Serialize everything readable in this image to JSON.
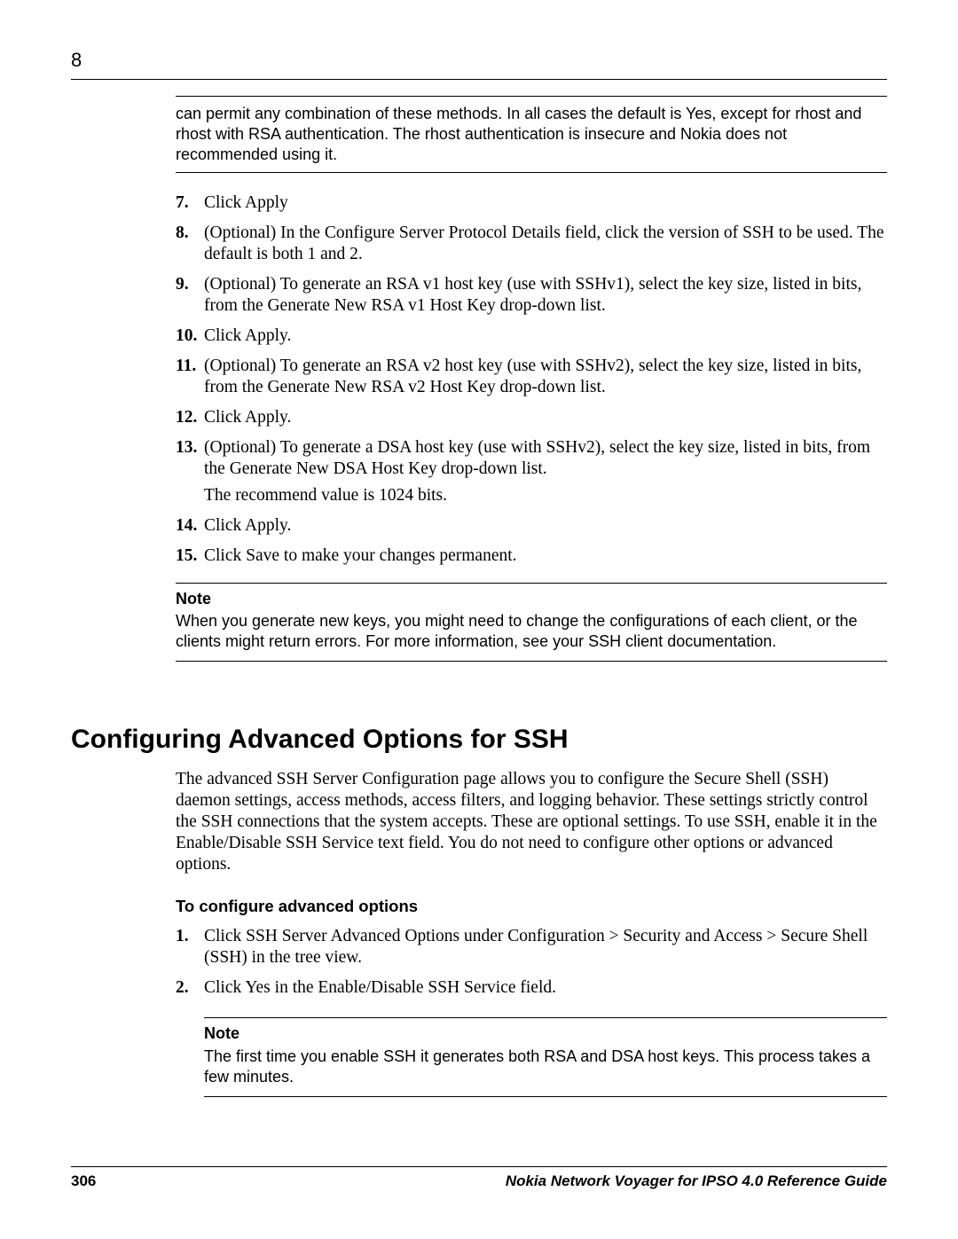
{
  "header": {
    "chapter_number": "8"
  },
  "intro_box": {
    "text": "can permit any combination of these methods. In all cases the default is Yes, except for rhost and rhost with RSA authentication. The rhost authentication is insecure and Nokia does not recommended using it."
  },
  "steps_a": [
    {
      "num": "7.",
      "paras": [
        "Click Apply"
      ]
    },
    {
      "num": "8.",
      "paras": [
        "(Optional) In the Configure Server Protocol Details field, click the version of SSH to be used. The default is both 1 and 2."
      ]
    },
    {
      "num": "9.",
      "paras": [
        "(Optional) To generate an RSA v1 host key (use with SSHv1), select the key size, listed in bits, from the Generate New RSA v1 Host Key drop-down list."
      ]
    },
    {
      "num": "10.",
      "paras": [
        "Click Apply."
      ]
    },
    {
      "num": "11.",
      "paras": [
        "(Optional) To generate an RSA v2 host key (use with SSHv2), select the key size, listed in bits, from the Generate New RSA v2 Host Key drop-down list."
      ]
    },
    {
      "num": "12.",
      "paras": [
        "Click Apply."
      ]
    },
    {
      "num": "13.",
      "paras": [
        "(Optional) To generate a DSA host key (use with SSHv2), select the key size, listed in bits, from the Generate New DSA Host Key drop-down list.",
        "The recommend value is 1024 bits."
      ]
    },
    {
      "num": "14.",
      "paras": [
        "Click Apply."
      ]
    },
    {
      "num": "15.",
      "paras": [
        "Click Save to make your changes permanent."
      ]
    }
  ],
  "note_a": {
    "title": "Note",
    "text": "When you generate new keys, you might need to change the configurations of each client, or the clients might return errors. For more information, see your SSH client documentation."
  },
  "section": {
    "heading": "Configuring Advanced Options for SSH",
    "lead": "The advanced SSH Server Configuration page allows you to configure the Secure Shell (SSH) daemon settings, access methods, access filters, and logging behavior. These settings strictly control the SSH connections that the system accepts. These are optional settings. To use SSH, enable it in the Enable/Disable SSH Service text field. You do not need to configure other options or advanced options.",
    "subhead": "To configure advanced options"
  },
  "steps_b": [
    {
      "num": "1.",
      "paras": [
        "Click SSH Server Advanced Options under Configuration > Security and Access > Secure Shell (SSH) in the tree view."
      ]
    },
    {
      "num": "2.",
      "paras": [
        "Click Yes in the Enable/Disable SSH Service field."
      ]
    }
  ],
  "note_b": {
    "title": "Note",
    "text": "The first time you enable SSH it generates both RSA and DSA host keys. This process takes a few minutes."
  },
  "footer": {
    "page_number": "306",
    "book_title": "Nokia Network Voyager for IPSO 4.0 Reference Guide"
  }
}
